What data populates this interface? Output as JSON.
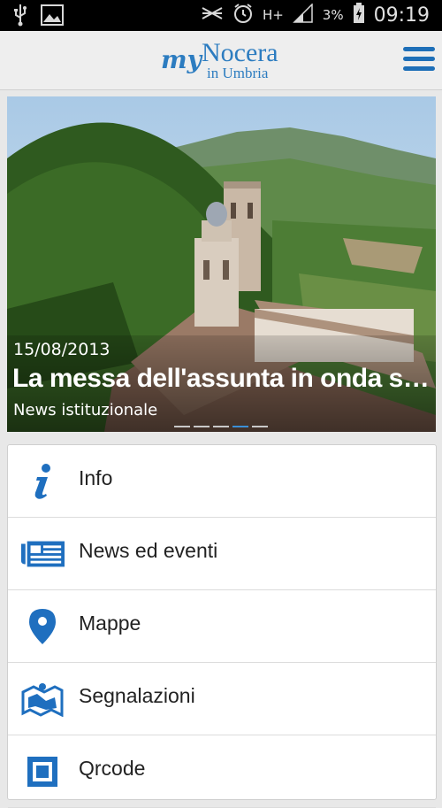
{
  "status_bar": {
    "battery": "3%",
    "time": "09:19",
    "network": "H+"
  },
  "app_bar": {
    "logo_my": "my",
    "logo_town": "Nocera",
    "logo_region": "in Umbria"
  },
  "hero": {
    "date": "15/08/2013",
    "title": "La messa dell'assunta in onda s…",
    "category": "News istituzionale",
    "slides": 5,
    "active_slide": 4
  },
  "menu": {
    "items": [
      {
        "label": "Info",
        "icon": "info-icon"
      },
      {
        "label": "News ed eventi",
        "icon": "newspaper-icon"
      },
      {
        "label": "Mappe",
        "icon": "map-pin-icon"
      },
      {
        "label": "Segnalazioni",
        "icon": "map-report-icon"
      },
      {
        "label": "Qrcode",
        "icon": "qrcode-icon"
      }
    ]
  },
  "colors": {
    "accent": "#2c7cc0",
    "icon_blue": "#1f6fbf"
  }
}
